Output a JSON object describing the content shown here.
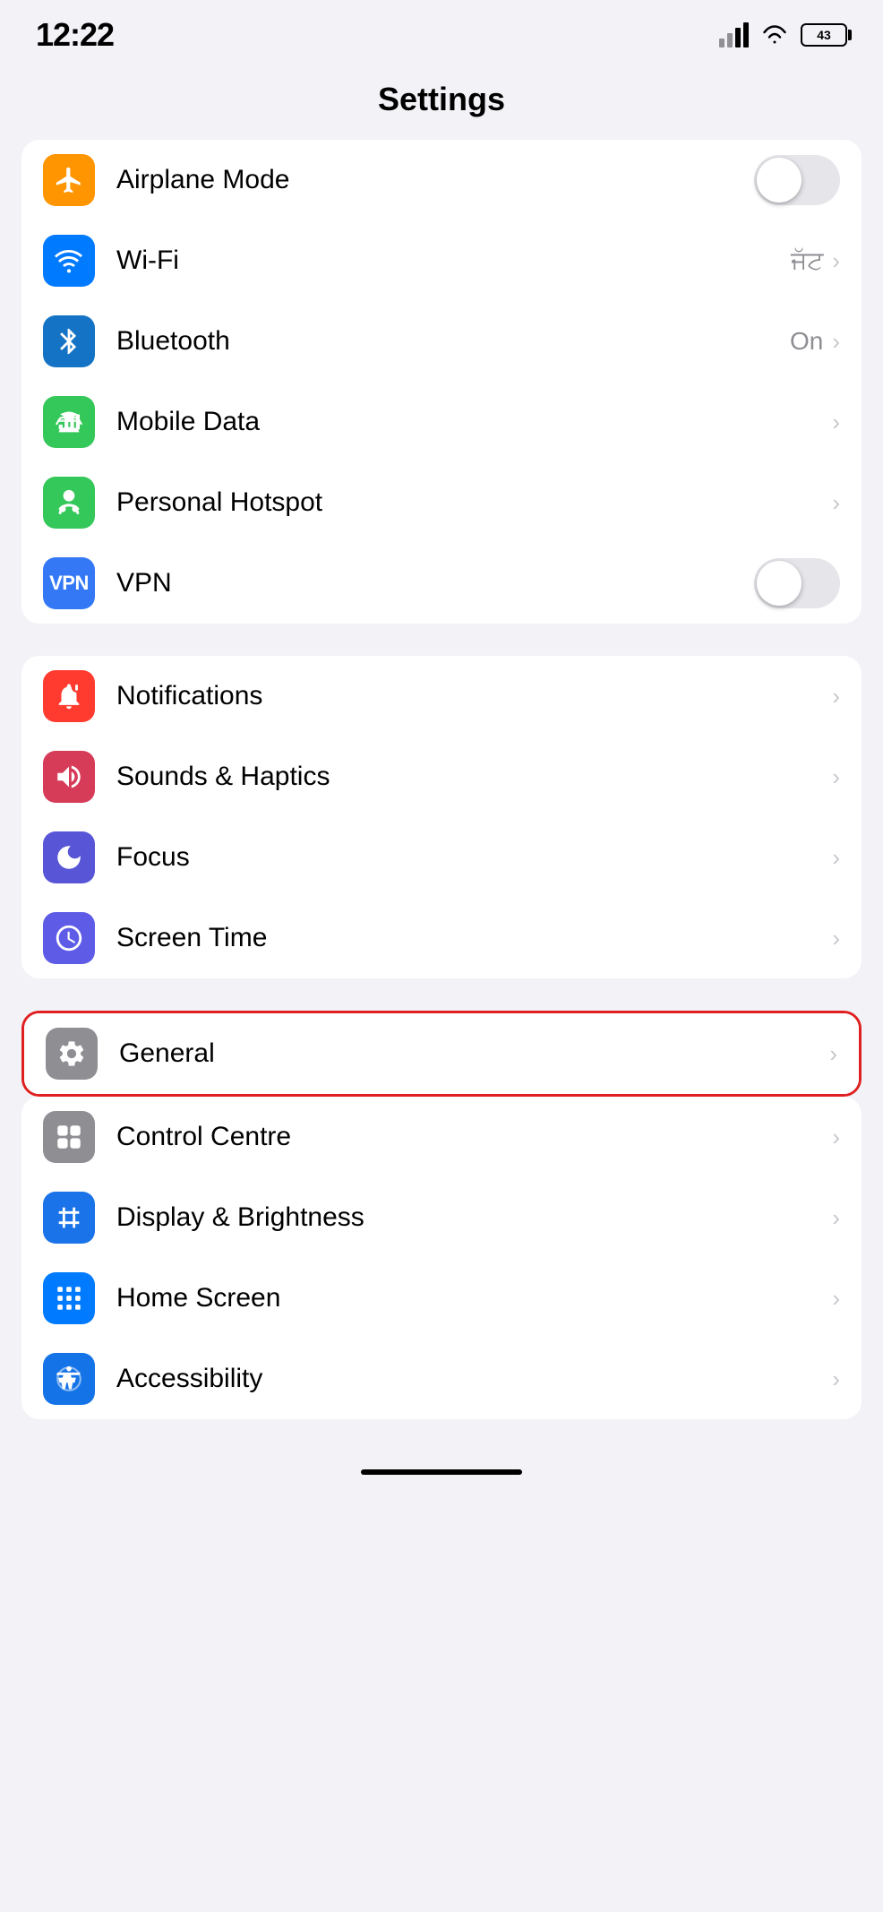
{
  "statusBar": {
    "time": "12:22",
    "battery": "43"
  },
  "header": {
    "title": "Settings"
  },
  "groups": [
    {
      "id": "connectivity",
      "rows": [
        {
          "id": "airplane-mode",
          "icon": "airplane",
          "iconColor": "orange",
          "label": "Airplane Mode",
          "type": "toggle",
          "toggleOn": false,
          "value": "",
          "chevron": false
        },
        {
          "id": "wifi",
          "icon": "wifi",
          "iconColor": "blue",
          "label": "Wi-Fi",
          "type": "value-chevron",
          "value": "ਜੱਟ",
          "chevron": true
        },
        {
          "id": "bluetooth",
          "icon": "bluetooth",
          "iconColor": "blue-mid",
          "label": "Bluetooth",
          "type": "value-chevron",
          "value": "On",
          "chevron": true
        },
        {
          "id": "mobile-data",
          "icon": "mobile",
          "iconColor": "green",
          "label": "Mobile Data",
          "type": "chevron",
          "value": "",
          "chevron": true
        },
        {
          "id": "personal-hotspot",
          "icon": "hotspot",
          "iconColor": "green",
          "label": "Personal Hotspot",
          "type": "chevron",
          "value": "",
          "chevron": true
        },
        {
          "id": "vpn",
          "icon": "vpn",
          "iconColor": "vpn",
          "label": "VPN",
          "type": "toggle",
          "toggleOn": false,
          "value": "",
          "chevron": false
        }
      ]
    },
    {
      "id": "system1",
      "rows": [
        {
          "id": "notifications",
          "icon": "notifications",
          "iconColor": "red",
          "label": "Notifications",
          "type": "chevron",
          "chevron": true
        },
        {
          "id": "sounds-haptics",
          "icon": "sounds",
          "iconColor": "pink",
          "label": "Sounds & Haptics",
          "type": "chevron",
          "chevron": true
        },
        {
          "id": "focus",
          "icon": "focus",
          "iconColor": "purple",
          "label": "Focus",
          "type": "chevron",
          "chevron": true
        },
        {
          "id": "screen-time",
          "icon": "screen-time",
          "iconColor": "purple-dark",
          "label": "Screen Time",
          "type": "chevron",
          "chevron": true
        }
      ]
    }
  ],
  "highlightedRow": {
    "id": "general",
    "icon": "general",
    "iconColor": "gray",
    "label": "General",
    "chevron": true
  },
  "bottomGroup": {
    "rows": [
      {
        "id": "control-centre",
        "icon": "control-centre",
        "iconColor": "gray",
        "label": "Control Centre",
        "chevron": true
      },
      {
        "id": "display-brightness",
        "icon": "display-brightness",
        "iconColor": "blue-aa",
        "label": "Display & Brightness",
        "chevron": true
      },
      {
        "id": "home-screen",
        "icon": "home-screen",
        "iconColor": "home",
        "label": "Home Screen",
        "chevron": true
      },
      {
        "id": "accessibility",
        "icon": "accessibility",
        "iconColor": "access",
        "label": "Accessibility",
        "chevron": true
      }
    ]
  },
  "labels": {
    "chevron": "›",
    "toggleOff": "",
    "toggleOn": ""
  }
}
